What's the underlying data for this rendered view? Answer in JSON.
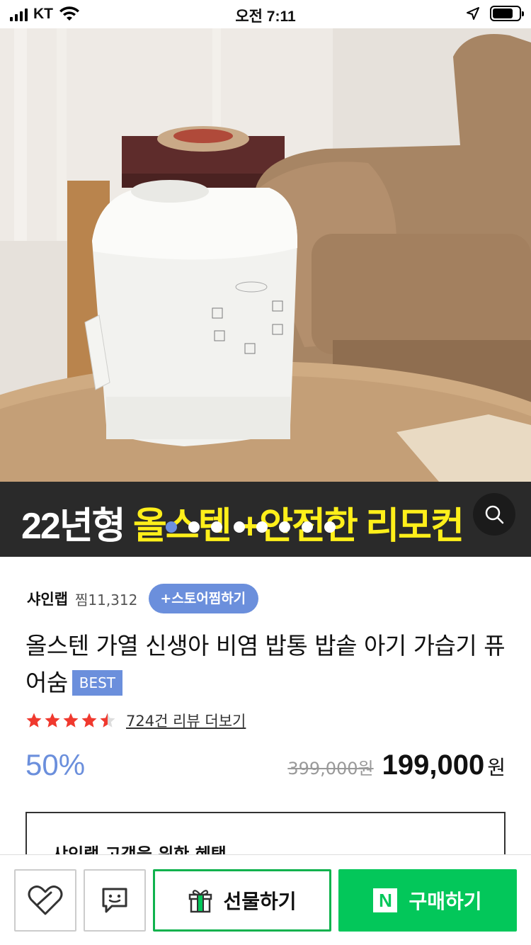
{
  "status_bar": {
    "carrier": "KT",
    "time": "오전 7:11"
  },
  "banner": {
    "text_white": "22년형 ",
    "text_highlight": "올스텐 +안전한 리모컨"
  },
  "store": {
    "name": "샤인랩",
    "fav_count": "찜11,312",
    "fav_button": "+스토어찜하기"
  },
  "product": {
    "title": "올스텐 가열 신생아 비염 밥통 밥솥 아기 가습기 퓨어숨",
    "badge": "BEST",
    "rating": 4.5,
    "review_link": "724건 리뷰 더보기",
    "discount": "50%",
    "original_price": "399,000원",
    "sale_price": "199,000",
    "currency": "원"
  },
  "benefit": {
    "title": "샤인랩 고객을 위한 혜택"
  },
  "bottom_bar": {
    "gift_label": "선물하기",
    "buy_label": "구매하기",
    "buy_logo": "N"
  },
  "colors": {
    "accent_blue": "#6b8fdc",
    "naver_green": "#03c75a",
    "star_red": "#f0392e",
    "banner_yellow": "#ffef1a"
  }
}
